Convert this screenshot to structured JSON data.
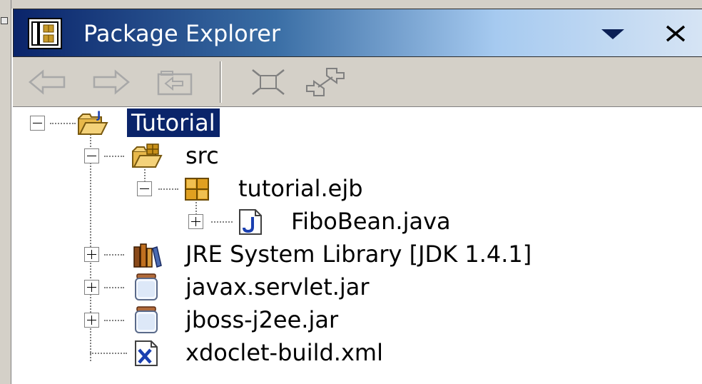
{
  "view": {
    "title": "Package Explorer",
    "title_icon": "package-explorer-icon",
    "menu_icon": "view-menu-triangle-icon",
    "close_icon": "close-icon"
  },
  "toolbar": {
    "back_icon": "back-arrow-icon",
    "forward_icon": "forward-arrow-icon",
    "up_icon": "up-folder-icon",
    "collapse_all_icon": "collapse-all-icon",
    "link_editor_icon": "link-with-editor-icon"
  },
  "tree": {
    "project": "Tutorial",
    "src": "src",
    "package": "tutorial.ejb",
    "file": "FiboBean.java",
    "jre": "JRE System Library [JDK 1.4.1]",
    "jar1": "javax.servlet.jar",
    "jar2": "jboss-j2ee.jar",
    "xml": "xdoclet-build.xml"
  },
  "colors": {
    "selection": "#0a246a",
    "title_gradient_start": "#0a246a",
    "title_gradient_end": "#d6e4f4",
    "chrome": "#d4d0c8"
  }
}
